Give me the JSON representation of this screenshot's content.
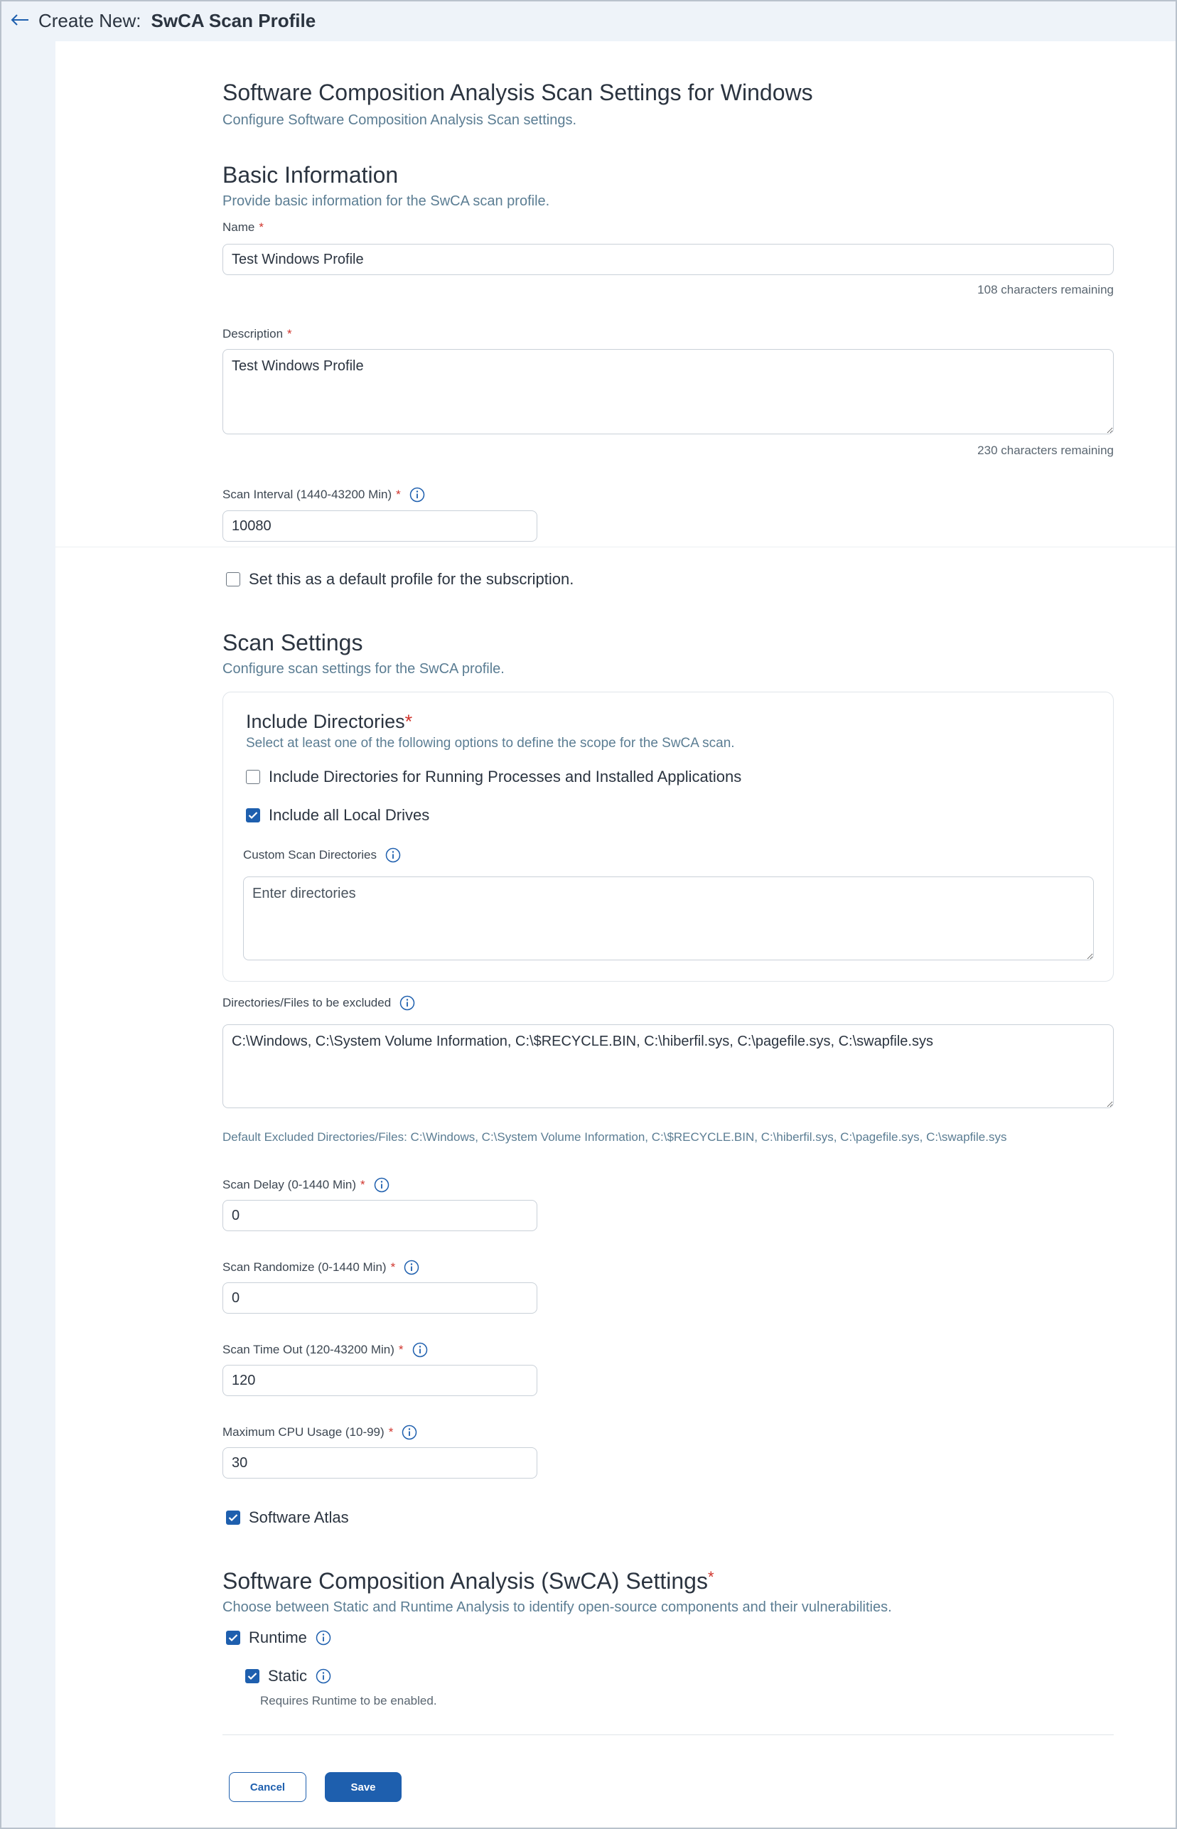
{
  "header": {
    "prefix": "Create New:",
    "title": "SwCA Scan Profile"
  },
  "page": {
    "title": "Software Composition Analysis Scan Settings for Windows",
    "subtitle": "Configure Software Composition Analysis Scan settings."
  },
  "basic": {
    "title": "Basic Information",
    "subtitle": "Provide basic information for the SwCA scan profile.",
    "name_label": "Name",
    "name_value": "Test Windows Profile",
    "name_hint": "108 characters remaining",
    "description_label": "Description",
    "description_value": "Test Windows Profile",
    "description_hint": "230 characters remaining",
    "interval_label": "Scan Interval (1440-43200 Min)",
    "interval_value": "10080",
    "default_label": "Set this as a default profile for the subscription.",
    "default_checked": false
  },
  "scan": {
    "title": "Scan Settings",
    "subtitle": "Configure scan settings for the SwCA profile.",
    "include_title": "Include Directories",
    "include_subtitle": "Select at least one of the following options to define the scope for the SwCA scan.",
    "opt_running_label": "Include Directories for Running Processes and Installed Applications",
    "opt_running_checked": false,
    "opt_local_label": "Include all Local Drives",
    "opt_local_checked": true,
    "custom_label": "Custom Scan Directories",
    "custom_placeholder": "Enter directories",
    "exclude_label": "Directories/Files to be excluded",
    "exclude_value": "C:\\Windows, C:\\System Volume Information, C:\\$RECYCLE.BIN, C:\\hiberfil.sys, C:\\pagefile.sys, C:\\swapfile.sys",
    "exclude_default": "Default Excluded Directories/Files: C:\\Windows, C:\\System Volume Information, C:\\$RECYCLE.BIN, C:\\hiberfil.sys, C:\\pagefile.sys, C:\\swapfile.sys",
    "delay_label": "Scan Delay (0-1440 Min)",
    "delay_value": "0",
    "randomize_label": "Scan Randomize (0-1440 Min)",
    "randomize_value": "0",
    "timeout_label": "Scan Time Out (120-43200 Min)",
    "timeout_value": "120",
    "cpu_label": "Maximum CPU Usage (10-99)",
    "cpu_value": "30",
    "atlas_label": "Software Atlas",
    "atlas_checked": true
  },
  "swca": {
    "title": "Software Composition Analysis (SwCA) Settings",
    "subtitle": "Choose between Static and Runtime Analysis to identify open-source components and their vulnerabilities.",
    "runtime_label": "Runtime",
    "runtime_checked": true,
    "static_label": "Static",
    "static_checked": true,
    "static_note": "Requires Runtime to be enabled."
  },
  "actions": {
    "cancel_label": "Cancel",
    "save_label": "Save"
  },
  "colors": {
    "accent": "#1e5fae",
    "required": "#d0342c",
    "subtitle": "#5b7d93"
  }
}
